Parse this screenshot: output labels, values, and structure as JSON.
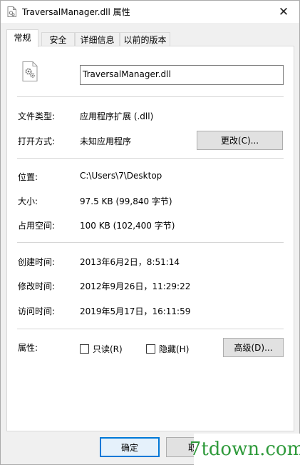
{
  "window": {
    "title": "TraversalManager.dll 属性",
    "close_glyph": "✕"
  },
  "tabs": [
    {
      "label": "常规",
      "active": true
    },
    {
      "label": "安全"
    },
    {
      "label": "详细信息"
    },
    {
      "label": "以前的版本"
    }
  ],
  "general": {
    "file_name": "TraversalManager.dll",
    "file_type_label": "文件类型:",
    "file_type_value": "应用程序扩展 (.dll)",
    "opens_with_label": "打开方式:",
    "opens_with_value": "未知应用程序",
    "change_button": "更改(C)...",
    "location_label": "位置:",
    "location_value": "C:\\Users\\7\\Desktop",
    "size_label": "大小:",
    "size_value": "97.5 KB (99,840 字节)",
    "size_on_disk_label": "占用空间:",
    "size_on_disk_value": "100 KB (102,400 字节)",
    "created_label": "创建时间:",
    "created_value": "2013年6月2日，8:51:14",
    "modified_label": "修改时间:",
    "modified_value": "2012年9月26日，11:29:22",
    "accessed_label": "访问时间:",
    "accessed_value": "2019年5月17日，16:11:59",
    "attributes_label": "属性:",
    "readonly_label": "只读(R)",
    "hidden_label": "隐藏(H)",
    "advanced_button": "高级(D)..."
  },
  "footer": {
    "ok_button": "确定",
    "cancel_button": "取"
  },
  "watermark": {
    "text": "7tdown.com",
    "color": "#2f9a3b"
  },
  "icons": [
    "dll-file-icon",
    "close-icon",
    "gear-file-icon"
  ]
}
